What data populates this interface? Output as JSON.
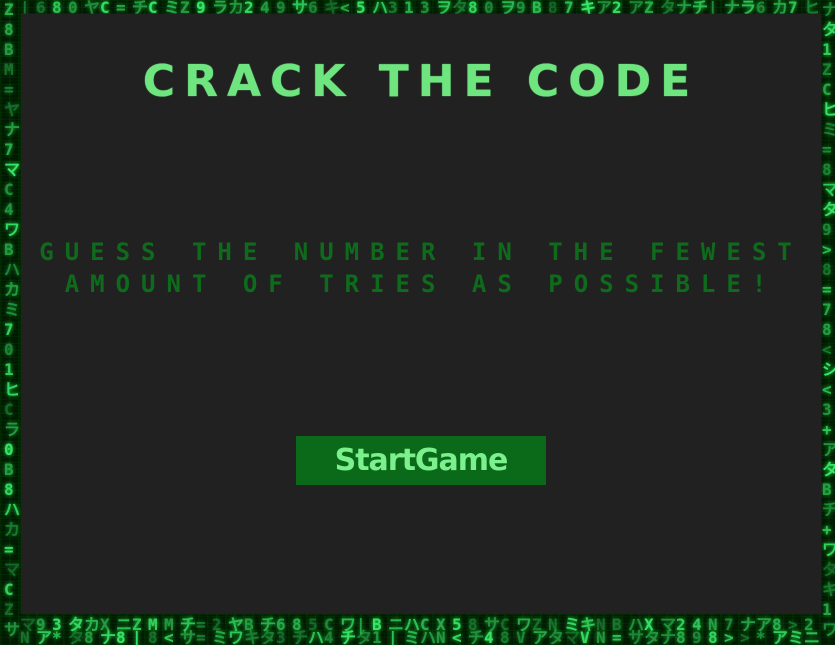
{
  "app": {
    "title": "Crack the Code",
    "instructions": "Guess the number in the fewest amount of tries as possible!",
    "start_button_label": "StartGame"
  },
  "theme": {
    "background": "#000000",
    "panel": "#212121",
    "title_color": "#6ee57f",
    "instruction_color": "#0f6b1c",
    "button_bg": "#0a6a1a",
    "button_text": "#7bf08c"
  }
}
